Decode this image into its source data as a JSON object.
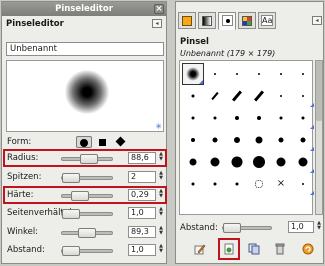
{
  "editor": {
    "window_title": "Pinseleditor",
    "dock_title": "Pinseleditor",
    "name": "Unbenannt",
    "shape_label": "Form:",
    "fields": [
      {
        "label": "Radius:",
        "value": "88,6",
        "level": 0.55,
        "highlighted": true
      },
      {
        "label": "Spitzen:",
        "value": "2",
        "level": 0.0,
        "highlighted": false
      },
      {
        "label": "Härte:",
        "value": "0,29",
        "level": 0.29,
        "highlighted": true
      },
      {
        "label": "Seitenverhältnis:",
        "value": "1,0",
        "level": 0.0,
        "highlighted": false
      },
      {
        "label": "Winkel:",
        "value": "89,3",
        "level": 0.5,
        "highlighted": false
      },
      {
        "label": "Abstand:",
        "value": "1,0",
        "level": 0.0,
        "highlighted": false
      }
    ],
    "shapes": [
      "circle",
      "square",
      "diamond"
    ],
    "active_shape": "circle"
  },
  "brushes": {
    "tabs": [
      "fg-bg-colors-icon",
      "gradient-icon",
      "brush-icon",
      "pattern-icon",
      "font-icon"
    ],
    "active_tab": 2,
    "title": "Pinsel",
    "subtitle": "Unbenannt (179 × 179)",
    "spacing_label": "Abstand:",
    "spacing_value": "1,0",
    "spacing_level": 0.0,
    "buttons": [
      "edit-brush-icon",
      "new-brush-icon",
      "duplicate-brush-icon",
      "delete-brush-icon",
      "refresh-brushes-icon"
    ],
    "highlighted_button": 1,
    "accent": "#5570d8",
    "highlight_color": "#c1131b"
  }
}
